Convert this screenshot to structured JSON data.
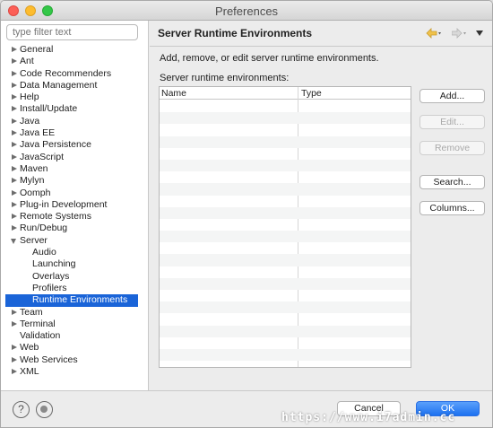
{
  "window": {
    "title": "Preferences"
  },
  "filter": {
    "placeholder": "type filter text"
  },
  "tree": [
    {
      "label": "General",
      "expandable": true,
      "expanded": false,
      "level": 0
    },
    {
      "label": "Ant",
      "expandable": true,
      "expanded": false,
      "level": 0
    },
    {
      "label": "Code Recommenders",
      "expandable": true,
      "expanded": false,
      "level": 0
    },
    {
      "label": "Data Management",
      "expandable": true,
      "expanded": false,
      "level": 0
    },
    {
      "label": "Help",
      "expandable": true,
      "expanded": false,
      "level": 0
    },
    {
      "label": "Install/Update",
      "expandable": true,
      "expanded": false,
      "level": 0
    },
    {
      "label": "Java",
      "expandable": true,
      "expanded": false,
      "level": 0
    },
    {
      "label": "Java EE",
      "expandable": true,
      "expanded": false,
      "level": 0
    },
    {
      "label": "Java Persistence",
      "expandable": true,
      "expanded": false,
      "level": 0
    },
    {
      "label": "JavaScript",
      "expandable": true,
      "expanded": false,
      "level": 0
    },
    {
      "label": "Maven",
      "expandable": true,
      "expanded": false,
      "level": 0
    },
    {
      "label": "Mylyn",
      "expandable": true,
      "expanded": false,
      "level": 0
    },
    {
      "label": "Oomph",
      "expandable": true,
      "expanded": false,
      "level": 0
    },
    {
      "label": "Plug-in Development",
      "expandable": true,
      "expanded": false,
      "level": 0
    },
    {
      "label": "Remote Systems",
      "expandable": true,
      "expanded": false,
      "level": 0
    },
    {
      "label": "Run/Debug",
      "expandable": true,
      "expanded": false,
      "level": 0
    },
    {
      "label": "Server",
      "expandable": true,
      "expanded": true,
      "level": 0
    },
    {
      "label": "Audio",
      "expandable": false,
      "expanded": false,
      "level": 1
    },
    {
      "label": "Launching",
      "expandable": false,
      "expanded": false,
      "level": 1
    },
    {
      "label": "Overlays",
      "expandable": false,
      "expanded": false,
      "level": 1
    },
    {
      "label": "Profilers",
      "expandable": false,
      "expanded": false,
      "level": 1
    },
    {
      "label": "Runtime Environments",
      "expandable": false,
      "expanded": false,
      "level": 1,
      "selected": true
    },
    {
      "label": "Team",
      "expandable": true,
      "expanded": false,
      "level": 0
    },
    {
      "label": "Terminal",
      "expandable": true,
      "expanded": false,
      "level": 0
    },
    {
      "label": "Validation",
      "expandable": false,
      "expanded": false,
      "level": 0
    },
    {
      "label": "Web",
      "expandable": true,
      "expanded": false,
      "level": 0
    },
    {
      "label": "Web Services",
      "expandable": true,
      "expanded": false,
      "level": 0
    },
    {
      "label": "XML",
      "expandable": true,
      "expanded": false,
      "level": 0
    }
  ],
  "page": {
    "title": "Server Runtime Environments",
    "description": "Add, remove, or edit server runtime environments.",
    "list_label": "Server runtime environments:",
    "columns": [
      "Name",
      "Type"
    ],
    "rows": []
  },
  "buttons": {
    "add": "Add...",
    "edit": "Edit...",
    "remove": "Remove",
    "search": "Search...",
    "columns": "Columns..."
  },
  "footer": {
    "cancel": "Cancel",
    "ok": "OK",
    "help_icon": "?",
    "watermark": "https://www.i7admin.cc"
  },
  "colors": {
    "selection": "#1a64d8",
    "ok_button": "#1d71f0",
    "nav_arrow": "#e8b13a"
  },
  "icons": {
    "back": "back-arrow-icon",
    "forward": "forward-arrow-icon",
    "menu": "view-menu-icon",
    "help": "help-icon",
    "import": "import-export-icon"
  }
}
